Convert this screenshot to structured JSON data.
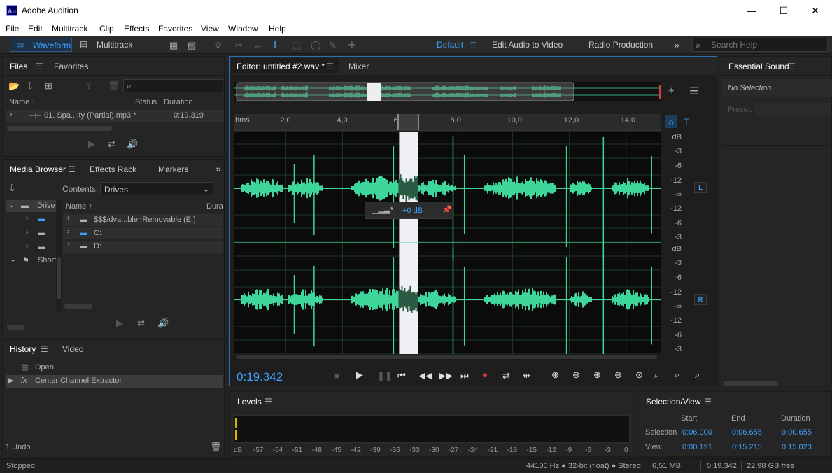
{
  "titlebar": {
    "logo": "Au",
    "title": "Adobe Audition",
    "minimize": "—",
    "maximize": "☐",
    "close": "✕"
  },
  "menu": [
    "File",
    "Edit",
    "Multitrack",
    "Clip",
    "Effects",
    "Favorites",
    "View",
    "Window",
    "Help"
  ],
  "toolbar": {
    "waveform": "Waveform",
    "multitrack": "Multitrack",
    "workspaces": [
      "Default",
      "Edit Audio to Video",
      "Radio Production"
    ],
    "more": "»",
    "search_placeholder": "Search Help"
  },
  "files_panel": {
    "tabs": [
      "Files",
      "Favorites"
    ],
    "columns": [
      "Name ↑",
      "Status",
      "Duration"
    ],
    "items": [
      {
        "name": "01. Spa...ity (Partial).mp3 *",
        "duration": "0:19.319"
      }
    ]
  },
  "media_panel": {
    "tabs": [
      "Media Browser",
      "Effects Rack",
      "Markers"
    ],
    "more": "»",
    "contents_label": "Contents:",
    "contents_value": "Drives",
    "tree": [
      "Drive",
      "",
      "",
      "",
      "Short"
    ],
    "columns": [
      "Name ↑",
      "Dura"
    ],
    "items": [
      "$$$/dva...ble=Removable (E:)",
      "C:",
      "D:"
    ]
  },
  "history_panel": {
    "tabs": [
      "History",
      "Video"
    ],
    "items": [
      {
        "label": "Open"
      },
      {
        "label": "Center Channel Extractor"
      }
    ],
    "undo_count": "1 Undo"
  },
  "editor": {
    "tabs": [
      "Editor: untitled #2.wav *",
      "Mixer"
    ],
    "ruler_unit": "hms",
    "ruler_ticks": [
      "2,0",
      "4,0",
      "6,0",
      "8,0",
      "10,0",
      "12,0",
      "14,0"
    ],
    "db_left": [
      "dB",
      "-3",
      "-6",
      "-12",
      "-∞",
      "-12",
      "-6",
      "-3"
    ],
    "db_right": [
      "dB",
      "-3",
      "-6",
      "-12",
      "-∞",
      "-12",
      "-6",
      "-3"
    ],
    "channel_left": "L",
    "channel_right": "R",
    "hud_gain": "+0 dB",
    "time_display": "0:19.342",
    "waveform_color": "#3ed69a",
    "selection_start_s": 6.0,
    "selection_end_s": 6.655,
    "view_start_s": 0.191,
    "view_end_s": 15.215,
    "total_s": 19.342
  },
  "essential_sound": {
    "title": "Essential Sound",
    "no_selection": "No Selection",
    "preset_label": "Preset:"
  },
  "levels": {
    "title": "Levels",
    "ticks": [
      "dB",
      "-57",
      "-54",
      "-51",
      "-48",
      "-45",
      "-42",
      "-39",
      "-36",
      "-33",
      "-30",
      "-27",
      "-24",
      "-21",
      "-18",
      "-15",
      "-12",
      "-9",
      "-6",
      "-3",
      "0"
    ]
  },
  "selection_view": {
    "title": "Selection/View",
    "headers": [
      "Start",
      "End",
      "Duration"
    ],
    "selection_label": "Selection",
    "view_label": "View",
    "selection": [
      "0:06.000",
      "0:06.655",
      "0:00.655"
    ],
    "view": [
      "0:00.191",
      "0:15.215",
      "0:15.023"
    ]
  },
  "status": {
    "state": "Stopped",
    "format": "44100 Hz ● 32-bit (float) ● Stereo",
    "size": "6,51 MB",
    "duration": "0:19.342",
    "free": "22,98 GB free"
  },
  "colors": {
    "accent": "#3ea0ff",
    "waveform": "#3ed69a",
    "record": "#e03c3c",
    "panel": "#252525"
  }
}
